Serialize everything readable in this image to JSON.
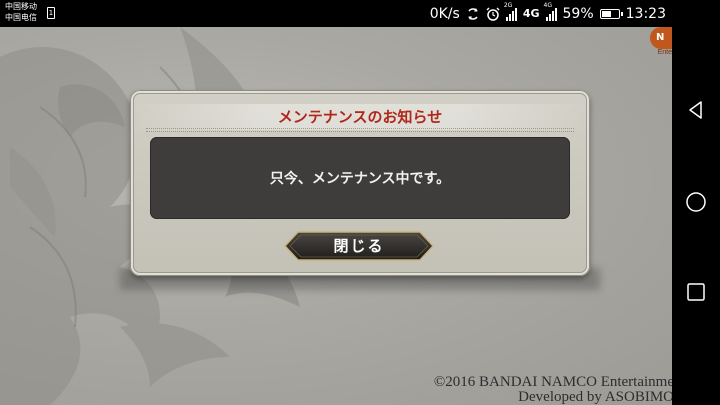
{
  "status_bar": {
    "carrier_1": "中国移动",
    "carrier_2": "中国电信",
    "speed": "0K/s",
    "network_1": "4G",
    "network_small_1": "2G",
    "network_small_2": "4G",
    "network_small_3": "2G",
    "battery_percent": "59%",
    "battery_level": 0.59,
    "time": "13:23"
  },
  "game": {
    "corner_logo_letter": "N",
    "corner_logo_text": "Ente",
    "copyright_line_1": "©2016 BANDAI NAMCO Entertainme",
    "copyright_line_2": "Developed by ASOBIMO"
  },
  "dialog": {
    "title": "メンテナンスのお知らせ",
    "message": "只今、メンテナンス中です。",
    "close_label": "閉じる"
  },
  "nav_bar": {
    "icons": [
      "back-icon",
      "home-icon",
      "recents-icon"
    ]
  },
  "colors": {
    "title_red": "#b0281b",
    "dialog_bg": "#c8c6bb",
    "message_bg": "#3e3d3b",
    "button_bg": "#2e2c2a",
    "button_border": "#c9b47a"
  }
}
